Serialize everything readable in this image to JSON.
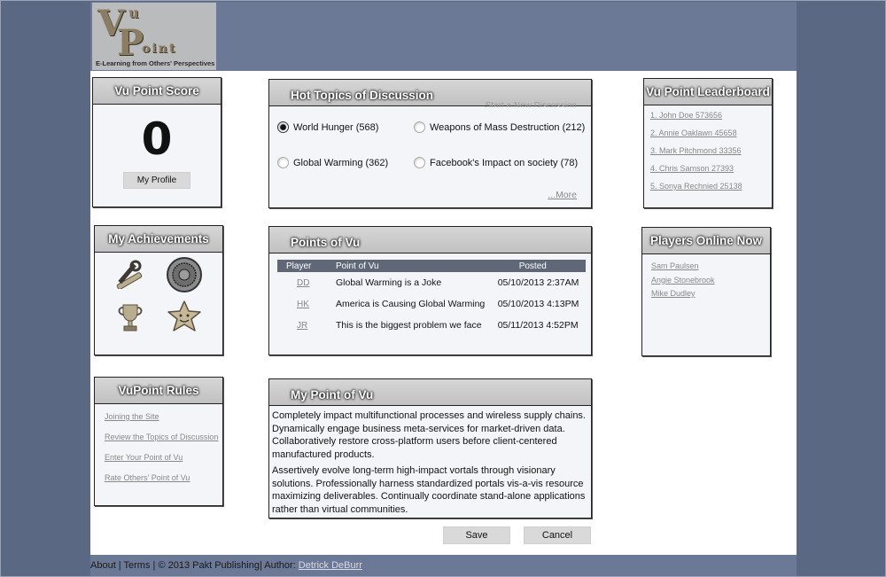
{
  "logo": {
    "mark_v": "V",
    "mark_u": "u",
    "mark_p": "P",
    "mark_oint": "oint",
    "tagline": "E-Learning from Others' Perspectives"
  },
  "score_panel": {
    "title": "Vu Point Score",
    "score": "0",
    "profile_button": "My Profile"
  },
  "hot_topics": {
    "title": "Hot Topics of Discussion",
    "new_discussion_link": "Start a New Discussion",
    "topics": [
      {
        "label": "World Hunger (568)",
        "selected": true
      },
      {
        "label": "Weapons of Mass Destruction (212)",
        "selected": false
      },
      {
        "label": "Global Warming (362)",
        "selected": false
      },
      {
        "label": "Facebook's Impact on  society (78)",
        "selected": false
      }
    ],
    "more_link": "...More"
  },
  "leaderboard": {
    "title": "Vu Point Leaderboard",
    "entries": [
      "1. John Doe 573656",
      "2. Annie Oaklawn 45658",
      "3. Mark Pitchmond 33356",
      "4. Chris Samson 27393",
      "5. Sonya Rechnied 25138"
    ]
  },
  "achievements": {
    "title": "My Achievements",
    "icons": [
      "tools-icon",
      "seal-icon",
      "trophy-icon",
      "star-icon"
    ]
  },
  "points_of_vu": {
    "title": "Points of Vu",
    "columns": [
      "Player",
      "Point of Vu",
      "Posted"
    ],
    "rows": [
      {
        "player": "DD",
        "point": "Global Warming is a Joke",
        "posted": "05/10/2013 2:37AM"
      },
      {
        "player": "HK",
        "point": "America is Causing Global Warming",
        "posted": "05/10/2013 4:13PM"
      },
      {
        "player": "JR",
        "point": "This is the biggest problem we face",
        "posted": "05/11/2013 4:52PM"
      }
    ]
  },
  "players_online": {
    "title": "Players Online Now",
    "players": [
      "Sam Paulsen",
      "Angie Stonebrook",
      "Mike Dudley"
    ]
  },
  "rules": {
    "title": "VuPoint Rules",
    "links": [
      "Joining the Site",
      "Review the Topics of Discussion",
      "Enter Your Point of Vu",
      "Rate Others' Point of Vu"
    ]
  },
  "my_point": {
    "title": "My Point of Vu",
    "paragraph1": "Completely impact multifunctional processes and wireless supply chains. Dynamically engage business meta-services for market-driven data. Collaboratively restore cross-platform users before client-centered manufactured products.",
    "paragraph2": "Assertively evolve long-term high-impact vortals through visionary solutions. Professionally harness standardized portals vis-a-vis resource maximizing deliverables. Continually coordinate stand-alone applications rather than virtual communities."
  },
  "actions": {
    "save": "Save",
    "cancel": "Cancel"
  },
  "footer": {
    "about": "About",
    "sep1": " | ",
    "terms": "Terms",
    "copyright": " | © 2013 Pakt Publishing| Author: ",
    "author": "Detrick DeBurr"
  }
}
